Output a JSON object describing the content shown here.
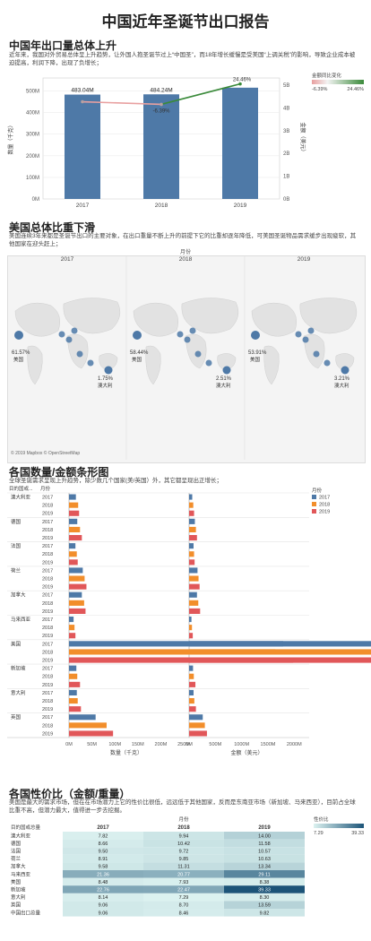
{
  "page": {
    "title": "中国近年圣诞节出口报告",
    "s1_title": "中国年出口量总体上升",
    "s1_desc": "近年来，我国对外贸易总体呈上升趋势，让外国人抱圣诞节过上“中国圣”，而18年增长缓慢是受美国“上调关税”的影响，导致企业成本被迫提高，利润下降，出现了负增长；",
    "s2_title": "美国总体比重下滑",
    "s2_desc": "美国连续3年来都是圣诞节出口的主要对象，在出口重量不断上升的前提下它的比重却逐年降低，可美国圣诞物品需求缓步出现疲软，其他国家在迎头赶上；",
    "s3_title": "各国数量/金额条形图",
    "s3_desc": "全球圣诞需求呈现上升趋势，除少数几个国家(美/英国）外，其它都呈现出正增长；",
    "s4_title": "各国性价比（金额/重量）",
    "s4_desc": "美国是最大的需求市场，但在在市场潜力上它的性价比很低，远远低于其他国家，反而是东南亚市场（新加坡、马来西亚），目前占全球比重不高，但潜力最大，值得进一步去挖掘。",
    "map_copyright": "© 2019 Mapbox © OpenStreetMap"
  },
  "colors": {
    "y2017": "#4e79a7",
    "y2018": "#f28e2b",
    "y2019": "#e15759",
    "bar": "#4e79a7",
    "growth_pos": "#3a8a3a",
    "growth_neg": "#e8a0a0"
  },
  "chart_data": [
    {
      "type": "bar",
      "title": "中国年出口量总体上升",
      "categories": [
        "2017",
        "2018",
        "2019"
      ],
      "series": [
        {
          "name": "数量（千克）",
          "values": [
            483.04,
            484.24,
            515.0
          ],
          "labels": [
            "483.04M",
            "484.24M",
            ""
          ]
        },
        {
          "name": "金额同比变化",
          "values": [
            null,
            -6.39,
            24.46
          ],
          "labels": [
            "",
            "-6.39%",
            "24.46%"
          ]
        }
      ],
      "ylabel_left": "数量（千克）",
      "ylabel_right": "金额（美元）",
      "yticks_left": [
        "0M",
        "100M",
        "200M",
        "300M",
        "400M",
        "500M"
      ],
      "yticks_right": [
        "0B",
        "1B",
        "2B",
        "3B",
        "4B",
        "5B"
      ],
      "ylim": [
        0,
        560
      ],
      "legend": {
        "title": "金额同比变化",
        "min": "-6.39%",
        "max": "24.46%"
      }
    },
    {
      "type": "map",
      "title": "美国总体比重下滑",
      "axis_header": "月份",
      "panels": [
        {
          "year": "2017",
          "us": "61.57%",
          "au": "1.75%",
          "us_label": "美国",
          "au_label": "澳大利"
        },
        {
          "year": "2018",
          "us": "58.44%",
          "au": "2.51%",
          "us_label": "美国",
          "au_label": "澳大利"
        },
        {
          "year": "2019",
          "us": "53.91%",
          "au": "3.21%",
          "us_label": "美国",
          "au_label": "澳大利"
        }
      ]
    },
    {
      "type": "bar",
      "title": "各国数量/金额条形图",
      "header_country": "目的国或...",
      "header_month": "月份",
      "legend_title": "月份",
      "years": [
        "2017",
        "2018",
        "2019"
      ],
      "countries": [
        "澳大利亚",
        "德国",
        "法国",
        "荷兰",
        "加拿大",
        "马来西亚",
        "美国",
        "新加坡",
        "意大利",
        "英国"
      ],
      "quantity": [
        [
          15,
          20,
          22
        ],
        [
          18,
          24,
          28
        ],
        [
          14,
          17,
          19
        ],
        [
          30,
          34,
          38
        ],
        [
          28,
          33,
          36
        ],
        [
          10,
          12,
          14
        ],
        [
          1630,
          1520,
          1900
        ],
        [
          16,
          18,
          24
        ],
        [
          17,
          19,
          26
        ],
        [
          58,
          82,
          96
        ]
      ],
      "amount": [
        [
          60,
          80,
          95
        ],
        [
          110,
          130,
          150
        ],
        [
          85,
          95,
          105
        ],
        [
          160,
          180,
          200
        ],
        [
          150,
          175,
          210
        ],
        [
          45,
          55,
          70
        ],
        [
          1790,
          1640,
          1980
        ],
        [
          75,
          90,
          120
        ],
        [
          85,
          100,
          130
        ],
        [
          260,
          300,
          340
        ]
      ],
      "xlabel_left": "数量（千克）",
      "xlabel_right": "金额（美元）",
      "xticks_left": [
        "0M",
        "50M",
        "100M",
        "150M",
        "200M",
        "250M"
      ],
      "xticks_right": [
        "0M",
        "500M",
        "1000M",
        "1500M",
        "2000M"
      ],
      "xlim_left": [
        0,
        250
      ],
      "xlim_right": [
        0,
        2200
      ]
    },
    {
      "type": "heatmap",
      "title": "各国性价比（金额/重量）",
      "legend_title": "性价比",
      "legend_min": "7.29",
      "legend_max": "39.33",
      "header_country": "目的国或总量",
      "header_month": "月份",
      "years": [
        "2017",
        "2018",
        "2019"
      ],
      "rows": [
        {
          "name": "澳大利亚",
          "values": [
            "7.82",
            "9.94",
            "14.00"
          ]
        },
        {
          "name": "德国",
          "values": [
            "8.66",
            "10.42",
            "11.58"
          ]
        },
        {
          "name": "法国",
          "values": [
            "9.50",
            "9.72",
            "10.57"
          ]
        },
        {
          "name": "荷兰",
          "values": [
            "8.91",
            "9.85",
            "10.63"
          ]
        },
        {
          "name": "加拿大",
          "values": [
            "9.58",
            "11.31",
            "13.34"
          ]
        },
        {
          "name": "马来西亚",
          "values": [
            "21.36",
            "20.77",
            "29.11"
          ]
        },
        {
          "name": "美国",
          "values": [
            "8.48",
            "7.93",
            "8.38"
          ]
        },
        {
          "name": "新加坡",
          "values": [
            "22.76",
            "22.47",
            "39.33"
          ]
        },
        {
          "name": "意大利",
          "values": [
            "8.14",
            "7.29",
            "8.30"
          ]
        },
        {
          "name": "英国",
          "values": [
            "9.06",
            "8.70",
            "13.59"
          ]
        },
        {
          "name": "中国出口总量",
          "values": [
            "9.06",
            "8.46",
            "9.82"
          ]
        }
      ]
    }
  ]
}
